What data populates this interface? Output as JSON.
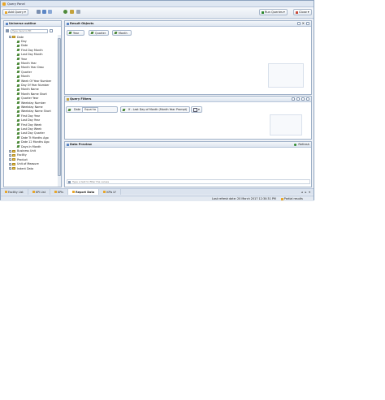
{
  "window": {
    "title": "Query Panel"
  },
  "toolbar": {
    "add_query_label": "Add Query",
    "run_queries_label": "Run Queries",
    "close_label": "Close"
  },
  "universe": {
    "title": "Universe outline",
    "search_placeholder": "Type here to filt",
    "items": [
      {
        "label": "Date",
        "type": "folder-open"
      },
      {
        "label": "Day",
        "type": "dim"
      },
      {
        "label": "Date",
        "type": "dim"
      },
      {
        "label": "First Day Month",
        "type": "dim"
      },
      {
        "label": "Last Day Month",
        "type": "dim"
      },
      {
        "label": "Year",
        "type": "dim"
      },
      {
        "label": "Month Year",
        "type": "dim"
      },
      {
        "label": "Month Year Desc",
        "type": "dim"
      },
      {
        "label": "Quarter",
        "type": "dim"
      },
      {
        "label": "Month",
        "type": "dim"
      },
      {
        "label": "Week Of Year Number",
        "type": "dim"
      },
      {
        "label": "Day Of Year Number",
        "type": "dim"
      },
      {
        "label": "Month Name",
        "type": "dim"
      },
      {
        "label": "Month Name Short",
        "type": "dim"
      },
      {
        "label": "Quarter Year",
        "type": "dim"
      },
      {
        "label": "Weekday Number",
        "type": "dim"
      },
      {
        "label": "Weekday Name",
        "type": "dim"
      },
      {
        "label": "Weekday Name Short",
        "type": "dim"
      },
      {
        "label": "First Day Year",
        "type": "dim"
      },
      {
        "label": "Last Day Year",
        "type": "dim"
      },
      {
        "label": "First Day Week",
        "type": "dim"
      },
      {
        "label": "Last Day Week",
        "type": "dim"
      },
      {
        "label": "Last Day Quarter",
        "type": "dim"
      },
      {
        "label": "Date Tt Months Ago",
        "type": "dim"
      },
      {
        "label": "Date 12 Months Ago",
        "type": "dim"
      },
      {
        "label": "Days In Month",
        "type": "dim"
      },
      {
        "label": "Business Unit",
        "type": "folder"
      },
      {
        "label": "Facility",
        "type": "folder"
      },
      {
        "label": "Product",
        "type": "folder"
      },
      {
        "label": "Unit of Measure",
        "type": "folder"
      },
      {
        "label": "Indent Data",
        "type": "folder"
      }
    ]
  },
  "result_objects": {
    "title": "Result Objects",
    "chips": [
      "Year",
      "Quarter",
      "Month"
    ]
  },
  "query_filters": {
    "title": "Query Filters",
    "filter1": {
      "object": "Date",
      "operator": "Equal to"
    },
    "filter2": {
      "object": "If - Last Day of Month (Month Year Prompt)"
    }
  },
  "data_preview": {
    "title": "Data Preview",
    "refresh_label": "Refresh",
    "filter_placeholder": "Type a text to filter the values"
  },
  "tabs": [
    {
      "label": "Facility List",
      "active": false
    },
    {
      "label": "KPI List",
      "active": false
    },
    {
      "label": "KPIs",
      "active": false
    },
    {
      "label": "Report Data",
      "active": true
    },
    {
      "label": "KPIs LY",
      "active": false
    }
  ],
  "status": {
    "last_refresh": "Last refresh date: 20 March 2017 12:30:31 PM",
    "partial": "Partial results"
  },
  "colors": {
    "accent": "#e8a628",
    "panel_border": "#9fb1c8",
    "dimension": "#4e8a3b"
  }
}
